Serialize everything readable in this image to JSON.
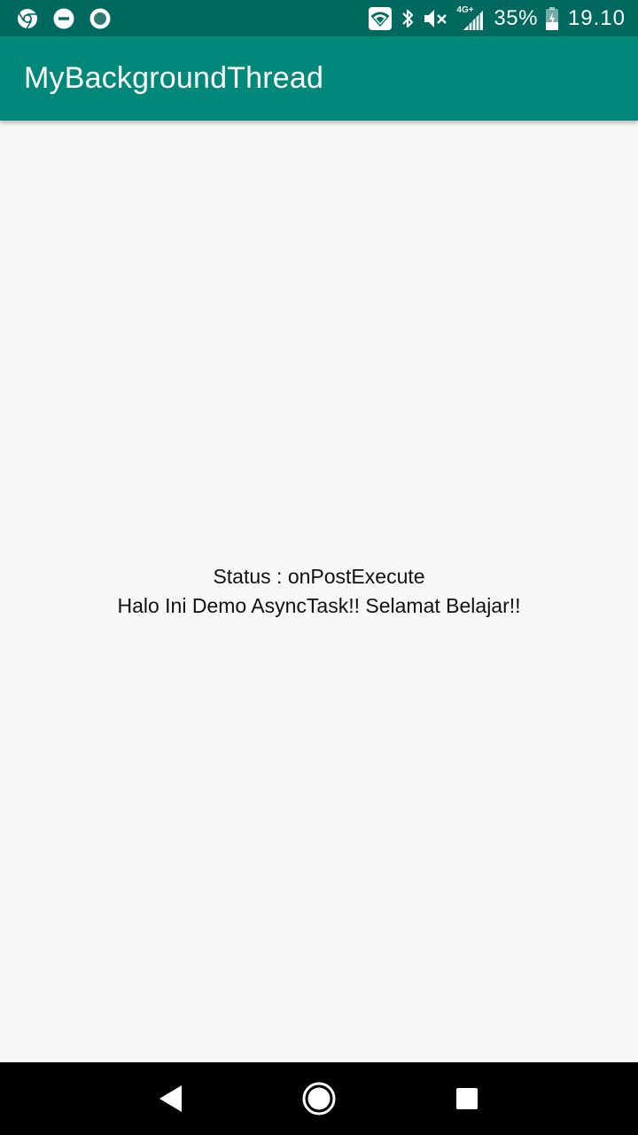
{
  "status_bar": {
    "left_icons": [
      "chrome-icon",
      "do-not-disturb-icon",
      "record-icon"
    ],
    "right_icons": [
      "wifi-icon",
      "bluetooth-icon",
      "mute-icon",
      "signal-4g-icon",
      "battery-icon"
    ],
    "network_label": "4G+",
    "battery_percent": "35%",
    "time": "19.10",
    "background": "#00695f"
  },
  "app_bar": {
    "title": "MyBackgroundThread",
    "background": "#00897b"
  },
  "main": {
    "status_line": "Status : onPostExecute",
    "message_line": "Halo Ini Demo AsyncTask!! Selamat Belajar!!"
  },
  "nav_bar": {
    "buttons": [
      "back-icon",
      "home-icon",
      "recents-icon"
    ]
  }
}
